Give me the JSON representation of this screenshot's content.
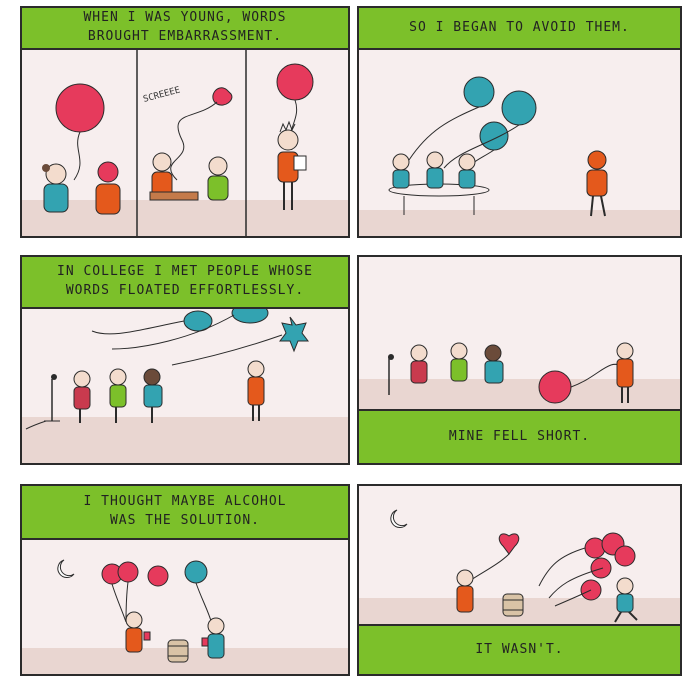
{
  "panels": [
    {
      "caption": "WHEN I WAS YOUNG, WORDS\nBROUGHT EMBARRASSMENT."
    },
    {
      "caption": "SO  I  BEGAN TO AVOID THEM."
    },
    {
      "caption": "IN COLLEGE I MET PEOPLE WHOSE\nWORDS FLOATED EFFORTLESSLY."
    },
    {
      "caption": "MINE FELL SHORT."
    },
    {
      "caption": "I THOUGHT MAYBE ALCOHOL\nWAS THE SOLUTION."
    },
    {
      "caption": "IT WASN'T."
    }
  ],
  "sound_effect": "SCREEEE",
  "colors": {
    "caption_green": "#7cc02a",
    "background": "#f7eeee",
    "floor": "#e9d6d1",
    "red_balloon": "#e63a5c",
    "teal_balloon": "#33a3b1",
    "orange_shirt": "#e4591c",
    "ink": "#2b2b2b"
  }
}
